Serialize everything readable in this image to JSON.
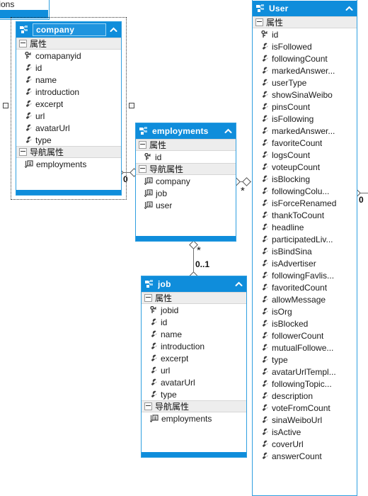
{
  "canvas": {
    "accent": "#0f8ddb",
    "border": "#2f9fe0",
    "section_bg": "#ededed",
    "bg": "#ffffff"
  },
  "partial_entity": {
    "name": "partial-entity-top-left",
    "visible_text": "tions"
  },
  "labels": {
    "attributes_section": "属性",
    "navigation_section": "导航属性",
    "collapse_caret": "^"
  },
  "entities": [
    {
      "name": "company",
      "title": "company",
      "title_editing": true,
      "selected": true,
      "attributes": [
        {
          "label": "comapanyid",
          "icon": "key-icon"
        },
        {
          "label": "id",
          "icon": "scalar-icon"
        },
        {
          "label": "name",
          "icon": "scalar-icon"
        },
        {
          "label": "introduction",
          "icon": "scalar-icon"
        },
        {
          "label": "excerpt",
          "icon": "scalar-icon"
        },
        {
          "label": "url",
          "icon": "scalar-icon"
        },
        {
          "label": "avatarUrl",
          "icon": "scalar-icon"
        },
        {
          "label": "type",
          "icon": "scalar-icon"
        }
      ],
      "navigation": [
        {
          "label": "employments",
          "icon": "navigation-icon"
        }
      ]
    },
    {
      "name": "employments",
      "title": "employments",
      "title_editing": false,
      "selected": false,
      "attributes": [
        {
          "label": "id",
          "icon": "key-icon"
        }
      ],
      "navigation": [
        {
          "label": "company",
          "icon": "navigation-icon"
        },
        {
          "label": "job",
          "icon": "navigation-icon"
        },
        {
          "label": "user",
          "icon": "navigation-icon"
        }
      ]
    },
    {
      "name": "job",
      "title": "job",
      "title_editing": false,
      "selected": false,
      "attributes": [
        {
          "label": "jobid",
          "icon": "key-icon"
        },
        {
          "label": "id",
          "icon": "scalar-icon"
        },
        {
          "label": "name",
          "icon": "scalar-icon"
        },
        {
          "label": "introduction",
          "icon": "scalar-icon"
        },
        {
          "label": "excerpt",
          "icon": "scalar-icon"
        },
        {
          "label": "url",
          "icon": "scalar-icon"
        },
        {
          "label": "avatarUrl",
          "icon": "scalar-icon"
        },
        {
          "label": "type",
          "icon": "scalar-icon"
        }
      ],
      "navigation": [
        {
          "label": "employments",
          "icon": "navigation-icon"
        }
      ]
    },
    {
      "name": "User",
      "title": "User",
      "title_editing": false,
      "selected": false,
      "attributes": [
        {
          "label": "id",
          "icon": "key-icon"
        },
        {
          "label": "isFollowed",
          "icon": "scalar-icon"
        },
        {
          "label": "followingCount",
          "icon": "scalar-icon"
        },
        {
          "label": "markedAnswer...",
          "icon": "scalar-icon"
        },
        {
          "label": "userType",
          "icon": "scalar-icon"
        },
        {
          "label": "showSinaWeibo",
          "icon": "scalar-icon"
        },
        {
          "label": "pinsCount",
          "icon": "scalar-icon"
        },
        {
          "label": "isFollowing",
          "icon": "scalar-icon"
        },
        {
          "label": "markedAnswer...",
          "icon": "scalar-icon"
        },
        {
          "label": "favoriteCount",
          "icon": "scalar-icon"
        },
        {
          "label": "logsCount",
          "icon": "scalar-icon"
        },
        {
          "label": "voteupCount",
          "icon": "scalar-icon"
        },
        {
          "label": "isBlocking",
          "icon": "scalar-icon"
        },
        {
          "label": "followingColu...",
          "icon": "scalar-icon"
        },
        {
          "label": "isForceRenamed",
          "icon": "scalar-icon"
        },
        {
          "label": "thankToCount",
          "icon": "scalar-icon"
        },
        {
          "label": "headline",
          "icon": "scalar-icon"
        },
        {
          "label": "participatedLiv...",
          "icon": "scalar-icon"
        },
        {
          "label": "isBindSina",
          "icon": "scalar-icon"
        },
        {
          "label": "isAdvertiser",
          "icon": "scalar-icon"
        },
        {
          "label": "followingFavlis...",
          "icon": "scalar-icon"
        },
        {
          "label": "favoritedCount",
          "icon": "scalar-icon"
        },
        {
          "label": "allowMessage",
          "icon": "scalar-icon"
        },
        {
          "label": "isOrg",
          "icon": "scalar-icon"
        },
        {
          "label": "isBlocked",
          "icon": "scalar-icon"
        },
        {
          "label": "followerCount",
          "icon": "scalar-icon"
        },
        {
          "label": "mutualFollowe...",
          "icon": "scalar-icon"
        },
        {
          "label": "type",
          "icon": "scalar-icon"
        },
        {
          "label": "avatarUrlTempl...",
          "icon": "scalar-icon"
        },
        {
          "label": "followingTopic...",
          "icon": "scalar-icon"
        },
        {
          "label": "description",
          "icon": "scalar-icon"
        },
        {
          "label": "voteFromCount",
          "icon": "scalar-icon"
        },
        {
          "label": "sinaWeiboUrl",
          "icon": "scalar-icon"
        },
        {
          "label": "isActive",
          "icon": "scalar-icon"
        },
        {
          "label": "coverUrl",
          "icon": "scalar-icon"
        },
        {
          "label": "answerCount",
          "icon": "scalar-icon"
        }
      ],
      "navigation": []
    }
  ],
  "associations": [
    {
      "name": "company-employments",
      "left_multiplicity": "0",
      "right_multiplicity": ""
    },
    {
      "name": "employments-job",
      "source_multiplicity": "*",
      "target_multiplicity": "0..1"
    },
    {
      "name": "employments-user",
      "source_multiplicity": "*",
      "target_multiplicity": "0"
    }
  ]
}
